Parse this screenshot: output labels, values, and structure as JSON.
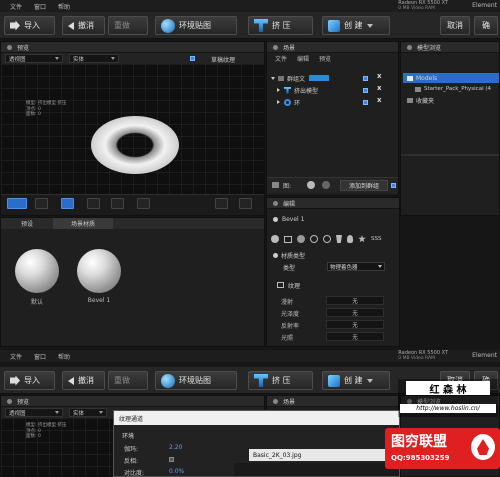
{
  "menu": [
    "文件",
    "窗口",
    "帮助"
  ],
  "gpu": {
    "name": "Radeon RX 5500 XT",
    "vram": "0 MB Video RAM"
  },
  "app_label": "Element",
  "toolbar": {
    "import": "导入",
    "undo": "撤消",
    "redo": "重做",
    "env_map": "环境贴图",
    "extrude": "挤 压",
    "create": "创 建",
    "cancel": "取消",
    "ok": "确"
  },
  "preview": {
    "title": "预览",
    "camera_select": "透视图",
    "render_select": "实体",
    "draft_texture": "草稿纹理",
    "stats": [
      "模型: 挤出模型 挤压",
      "顶点: 0",
      "面数: 0"
    ]
  },
  "scene": {
    "title": "场景",
    "menu": [
      "文件",
      "编辑",
      "预览"
    ],
    "items": [
      {
        "label": "群组文",
        "tag": ""
      },
      {
        "label": "挤出模型"
      },
      {
        "label": "环"
      }
    ],
    "add_to_group": "添加到群组",
    "footer_label": "图:"
  },
  "model_browser": {
    "title": "模型浏览",
    "items": [
      {
        "label": "Models"
      },
      {
        "label": "Starter_Pack_Physical (4"
      },
      {
        "label": "收藏夹"
      }
    ]
  },
  "presets": {
    "tabs": [
      "预设",
      "场景材质"
    ],
    "spheres": [
      {
        "label": "默认"
      },
      {
        "label": "Bevel 1"
      }
    ]
  },
  "editor": {
    "title": "编辑",
    "material_name": "Bevel 1",
    "icon_row_label": "SSS",
    "material_type_header": "材质类型",
    "type_label": "类型",
    "type_value": "物理着色器",
    "texture_header": "纹理",
    "props": [
      {
        "label": "漫射",
        "value": "无"
      },
      {
        "label": "光泽度",
        "value": "无"
      },
      {
        "label": "反射率",
        "value": "无"
      },
      {
        "label": "光照",
        "value": "无"
      }
    ]
  },
  "dup": {
    "menu": [
      "文件",
      "窗口",
      "帮助"
    ],
    "gpu": {
      "name": "Radeon RX 5500 XT",
      "vram": "0 MB Video RAM"
    },
    "app_label": "Element",
    "toolbar": {
      "import": "导入",
      "undo": "撤消",
      "redo": "重做",
      "env_map": "环境贴图",
      "extrude": "挤 压",
      "create": "创 建",
      "cancel": "取消",
      "ok": "确"
    },
    "preview_title": "预览",
    "camera_select": "透视图",
    "render_select": "实体",
    "scene_title": "场景",
    "model_browser_title": "模型浏览",
    "stats": [
      "模型: 挤出模型 挤压",
      "顶点: 0",
      "面数: 0"
    ],
    "dialog": {
      "title": "纹理通道",
      "env_label": "环境",
      "items": [
        {
          "label": "伽玛:",
          "value": "2.20"
        },
        {
          "label": "反相:",
          "value": ""
        },
        {
          "label": "对比度:",
          "value": "0.0%"
        }
      ],
      "file": "Basic_2K_03.jpg"
    }
  },
  "watermark": {
    "title": "红 森 林",
    "url": "http://www.hoslin.cn/",
    "brand": "图穷联盟",
    "qq": "QQ:985303259"
  }
}
